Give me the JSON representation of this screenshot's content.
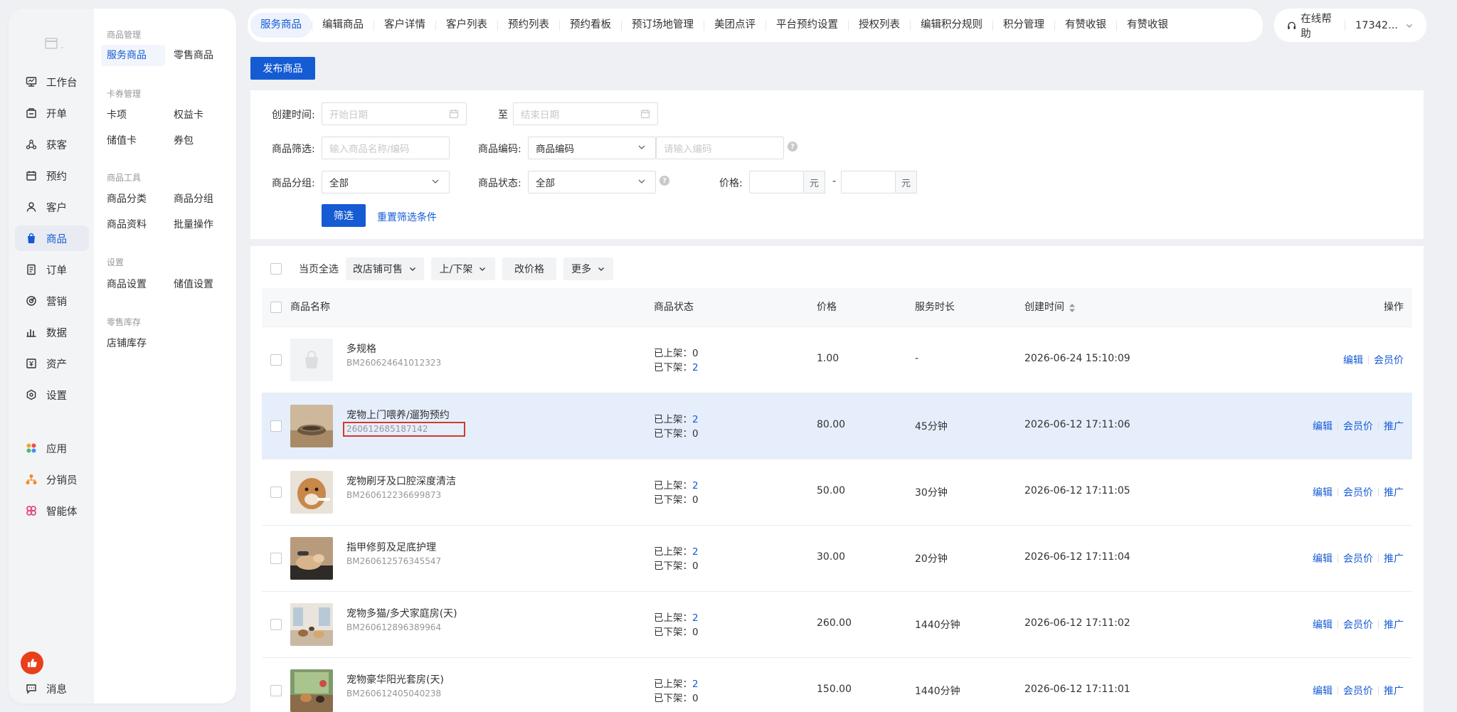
{
  "sidebar": {
    "primary": [
      {
        "label": "工作台",
        "icon": "dashboard-icon"
      },
      {
        "label": "开单",
        "icon": "cashier-icon"
      },
      {
        "label": "获客",
        "icon": "acquire-icon"
      },
      {
        "label": "预约",
        "icon": "calendar-icon"
      },
      {
        "label": "客户",
        "icon": "user-icon"
      },
      {
        "label": "商品",
        "icon": "shopping-bag-icon"
      },
      {
        "label": "订单",
        "icon": "order-icon"
      },
      {
        "label": "营销",
        "icon": "marketing-icon"
      },
      {
        "label": "数据",
        "icon": "chart-icon"
      },
      {
        "label": "资产",
        "icon": "asset-icon"
      },
      {
        "label": "设置",
        "icon": "gear-icon"
      },
      {
        "label": "应用",
        "icon": "apps-icon"
      },
      {
        "label": "分销员",
        "icon": "distributor-icon"
      },
      {
        "label": "智能体",
        "icon": "agent-icon"
      },
      {
        "label": "消息",
        "icon": "message-icon"
      }
    ],
    "secondary": {
      "group1_title": "商品管理",
      "group1_items": [
        "服务商品",
        "零售商品"
      ],
      "group2_title": "卡券管理",
      "group2_items": [
        "卡项",
        "权益卡",
        "储值卡",
        "券包"
      ],
      "group3_title": "商品工具",
      "group3_items": [
        "商品分类",
        "商品分组",
        "商品资料",
        "批量操作"
      ],
      "group4_title": "设置",
      "group4_items": [
        "商品设置",
        "储值设置"
      ],
      "group5_title": "零售库存",
      "group5_items": [
        "店铺库存"
      ]
    }
  },
  "topnav": {
    "tabs": [
      "服务商品",
      "编辑商品",
      "客户详情",
      "客户列表",
      "预约列表",
      "预约看板",
      "预订场地管理",
      "美团点评",
      "平台预约设置",
      "授权列表",
      "编辑积分规则",
      "积分管理",
      "有赞收银",
      "有赞收银"
    ],
    "help": "在线帮助",
    "user": "17342..."
  },
  "page": {
    "publish_button": "发布商品"
  },
  "filters": {
    "created_label": "创建时间:",
    "start_placeholder": "开始日期",
    "to": "至",
    "end_placeholder": "结束日期",
    "product_filter_label": "商品筛选:",
    "product_filter_placeholder": "输入商品名称/编码",
    "code_label": "商品编码:",
    "code_select": "商品编码",
    "code_placeholder": "请输入编码",
    "group_label": "商品分组:",
    "group_value": "全部",
    "status_label": "商品状态:",
    "status_value": "全部",
    "price_label": "价格:",
    "unit": "元",
    "dash": "-",
    "filter_button": "筛选",
    "reset_link": "重置筛选条件"
  },
  "bulk": {
    "select_all": "当页全选",
    "actions": [
      "改店铺可售",
      "上/下架",
      "改价格",
      "更多"
    ]
  },
  "table": {
    "headers": {
      "name": "商品名称",
      "status": "商品状态",
      "price": "价格",
      "duration": "服务时长",
      "created": "创建时间",
      "ops": "操作"
    },
    "status_on_label": "已上架：",
    "status_off_label": "已下架：",
    "op_edit": "编辑",
    "op_member": "会员价",
    "op_promote": "推广",
    "rows": [
      {
        "name": "多规格",
        "code": "BM260624641012323",
        "on": "0",
        "off": "2",
        "price": "1.00",
        "duration": "-",
        "created": "2026-06-24 15:10:09",
        "promote": false
      },
      {
        "name": "宠物上门喂养/遛狗预约",
        "code": "260612685187142",
        "on": "2",
        "off": "0",
        "price": "80.00",
        "duration": "45分钟",
        "created": "2026-06-12 17:11:06",
        "promote": true
      },
      {
        "name": "宠物刷牙及口腔深度清洁",
        "code": "BM260612236699873",
        "on": "2",
        "off": "0",
        "price": "50.00",
        "duration": "30分钟",
        "created": "2026-06-12 17:11:05",
        "promote": true
      },
      {
        "name": "指甲修剪及足底护理",
        "code": "BM260612576345547",
        "on": "2",
        "off": "0",
        "price": "30.00",
        "duration": "20分钟",
        "created": "2026-06-12 17:11:04",
        "promote": true
      },
      {
        "name": "宠物多猫/多犬家庭房(天)",
        "code": "BM260612896389964",
        "on": "2",
        "off": "0",
        "price": "260.00",
        "duration": "1440分钟",
        "created": "2026-06-12 17:11:02",
        "promote": true
      },
      {
        "name": "宠物豪华阳光套房(天)",
        "code": "BM260612405040238",
        "on": "2",
        "off": "0",
        "price": "150.00",
        "duration": "1440分钟",
        "created": "2026-06-12 17:11:01",
        "promote": true
      }
    ]
  },
  "colors": {
    "brand": "#155bd4",
    "highlight_row": "#e6eefc",
    "annotation_box": "#d03a2a"
  }
}
